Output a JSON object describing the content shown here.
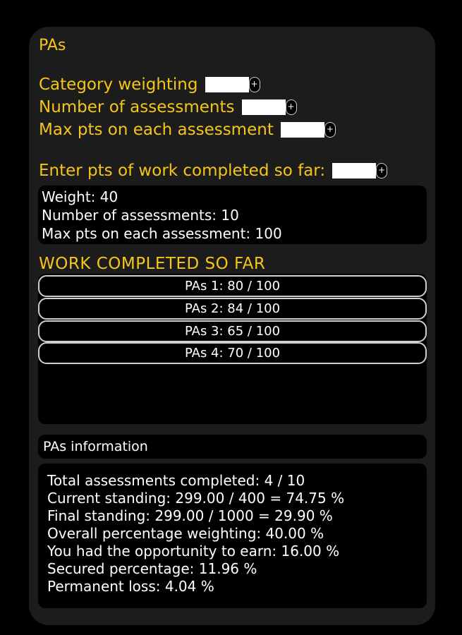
{
  "category": {
    "title": "PAs"
  },
  "form": {
    "weighting_label": "Category weighting",
    "assessments_label": "Number of assessments",
    "max_pts_label": "Max pts on each assessment",
    "completed_label": "Enter pts of work completed so far:",
    "add_icon": "+"
  },
  "summary": {
    "weight": "Weight: 40",
    "assessments": "Number of assessments: 10",
    "max_pts": "Max pts on each assessment: 100"
  },
  "work": {
    "heading": "WORK COMPLETED SO FAR",
    "items": [
      "PAs 1: 80 / 100",
      "PAs 2: 84 / 100",
      "PAs 3: 65 / 100",
      "PAs 4: 70 / 100"
    ]
  },
  "info": {
    "header": "PAs information",
    "lines": [
      "Total assessments completed: 4 / 10",
      "Current standing: 299.00 / 400 = 74.75 %",
      "Final standing: 299.00 / 1000 = 29.90 %",
      "Overall percentage weighting: 40.00 %",
      "You had the opportunity to earn: 16.00 %",
      "Secured percentage: 11.96 %",
      "Permanent loss: 4.04 %"
    ]
  },
  "colors": {
    "background": "#000000",
    "card": "#1c1c1c",
    "accent": "#f5c518",
    "text": "#ffffff"
  }
}
